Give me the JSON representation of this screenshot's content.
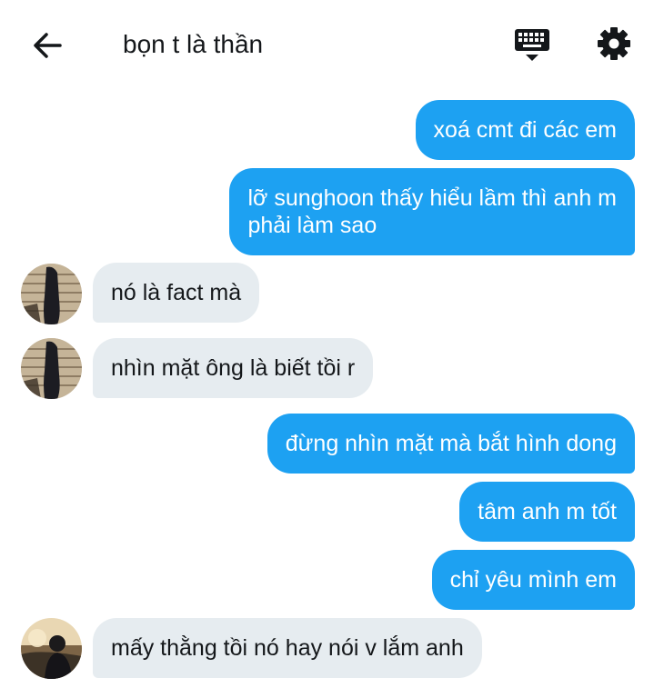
{
  "header": {
    "title": "bọn t là thần",
    "back_icon": "arrow-left-icon",
    "keyboard_icon": "keyboard-icon",
    "settings_icon": "gear-icon"
  },
  "colors": {
    "outgoing_bubble": "#1da1f2",
    "incoming_bubble": "#e6ecf0",
    "icon": "#14171a"
  },
  "messages": [
    {
      "side": "out",
      "text": "xoá cmt đi các em"
    },
    {
      "side": "out",
      "lines": [
        "lỡ sunghoon thấy hiểu lầm thì anh m",
        "phải làm sao"
      ]
    },
    {
      "side": "in",
      "text": "nó là fact mà"
    },
    {
      "side": "in",
      "text": "nhìn mặt ông là biết tồi r"
    },
    {
      "side": "out",
      "text": "đừng nhìn mặt mà bắt hình dong"
    },
    {
      "side": "out",
      "text": "tâm anh m tốt"
    },
    {
      "side": "out",
      "text": "chỉ yêu mình em"
    },
    {
      "side": "in",
      "text": "mấy thằng tồi nó hay nói v lắm anh"
    }
  ]
}
